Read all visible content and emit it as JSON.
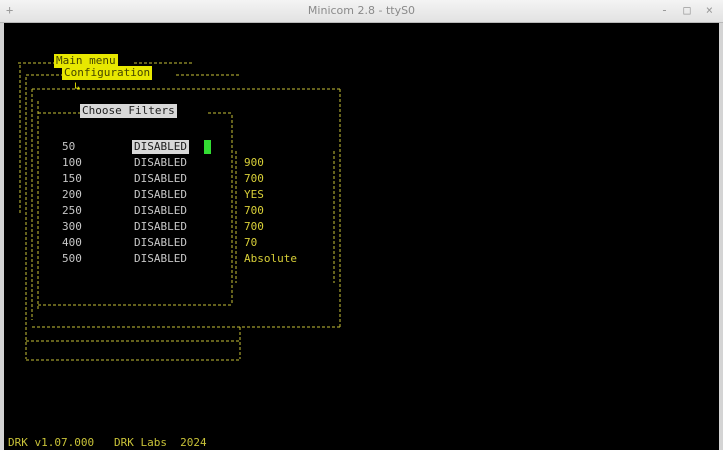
{
  "window": {
    "title": "Minicom 2.8 - ttyS0",
    "controls_left": "+",
    "controls_right": "- □ ×"
  },
  "menu": {
    "main_menu": "Main menu",
    "configuration": "Configuration",
    "chevron": "↳",
    "choose_filters": "Choose Filters"
  },
  "filters": [
    {
      "freq": "50",
      "state": "DISABLED",
      "value": ""
    },
    {
      "freq": "100",
      "state": "DISABLED",
      "value": "900"
    },
    {
      "freq": "150",
      "state": "DISABLED",
      "value": "700"
    },
    {
      "freq": "200",
      "state": "DISABLED",
      "value": "YES"
    },
    {
      "freq": "250",
      "state": "DISABLED",
      "value": "700"
    },
    {
      "freq": "300",
      "state": "DISABLED",
      "value": "700"
    },
    {
      "freq": "400",
      "state": "DISABLED",
      "value": "70"
    },
    {
      "freq": "500",
      "state": "DISABLED",
      "value": "Absolute"
    }
  ],
  "colors": {
    "terminal_bg": "#000000",
    "ascii_art": "#c8c238",
    "highlight_yellow": "#e8e800",
    "highlight_white": "#d8d8d8",
    "cursor": "#33dd33"
  },
  "footer": {
    "status": "DRK v1.07.000   DRK Labs  2024"
  }
}
